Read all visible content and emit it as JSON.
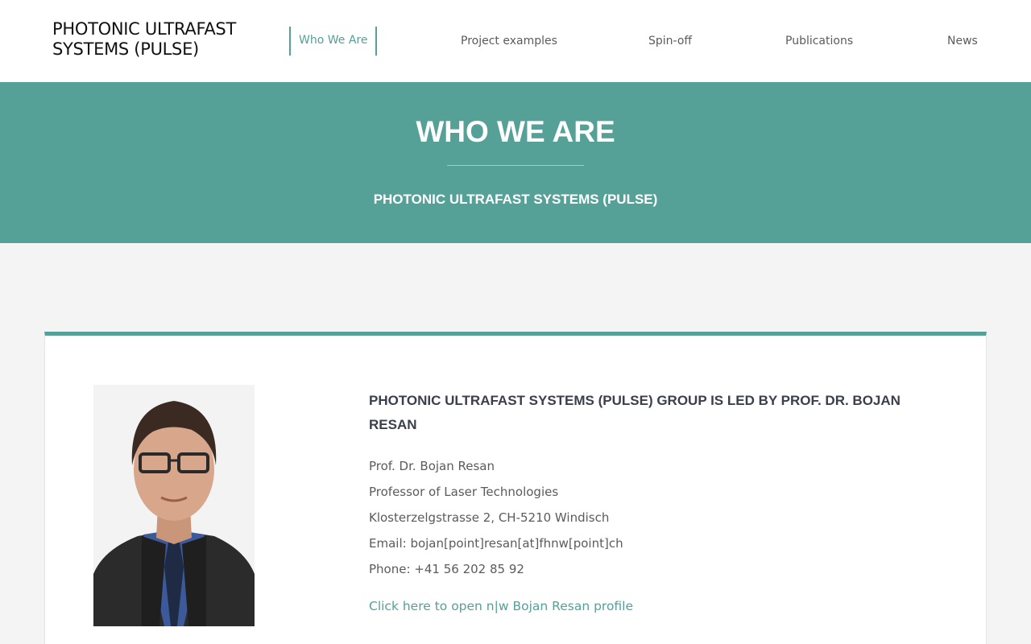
{
  "header": {
    "logo_line1": "PHOTONIC ULTRAFAST",
    "logo_line2": "SYSTEMS (PULSE)"
  },
  "nav": {
    "items": [
      {
        "label": "Who We Are",
        "active": true
      },
      {
        "label": "Project examples",
        "active": false
      },
      {
        "label": "Spin-off",
        "active": false
      },
      {
        "label": "Publications",
        "active": false
      },
      {
        "label": "News",
        "active": false
      }
    ]
  },
  "hero": {
    "title": "WHO WE ARE",
    "subtitle": "PHOTONIC ULTRAFAST SYSTEMS (PULSE)"
  },
  "profile": {
    "heading": "PHOTONIC ULTRAFAST SYSTEMS (PULSE) GROUP IS LED BY PROF. DR. BOJAN RESAN",
    "name": "Prof. Dr. Bojan Resan",
    "title": "Professor of Laser Technologies",
    "address": "Klosterzelgstrasse 2, CH-5210 Windisch",
    "email": "Email: bojan[point]resan[at]fhnw[point]ch",
    "phone": "Phone: +41 56 202 85 92",
    "link_label": "Click here to open n|w Bojan Resan profile"
  },
  "colors": {
    "accent": "#55a097",
    "page_background": "#f4f4f4",
    "heading_text": "#3a3f4b",
    "body_text": "#5b5b5b"
  }
}
